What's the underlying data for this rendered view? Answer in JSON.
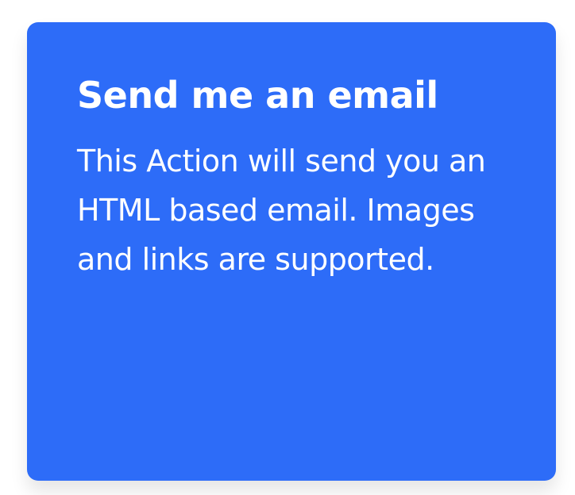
{
  "card": {
    "title": "Send me an email",
    "description": "This Action will send you an HTML based email. Images and links are supported.",
    "background_color": "#2d6cf8",
    "text_color": "#ffffff"
  }
}
